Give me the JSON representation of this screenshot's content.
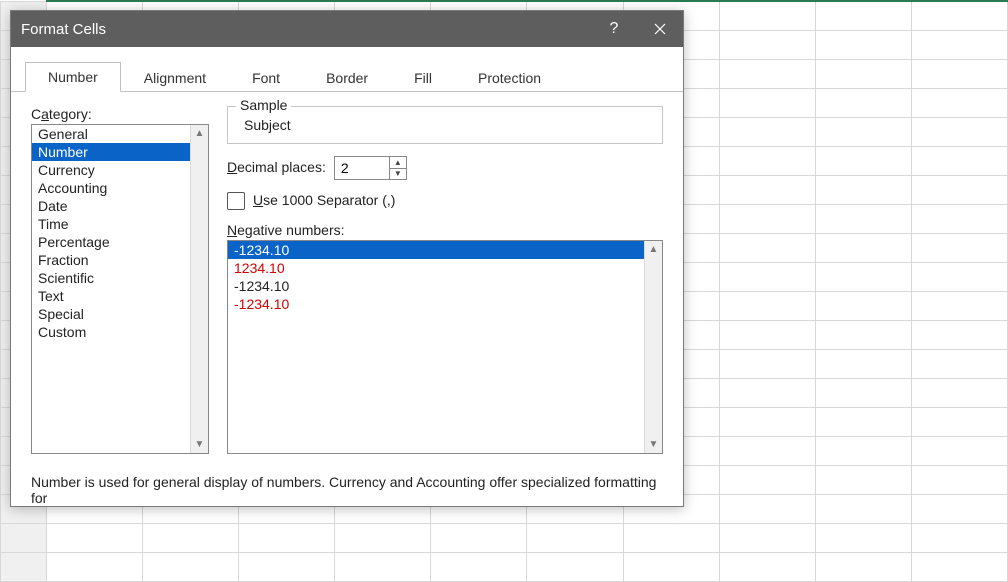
{
  "dialog": {
    "title": "Format Cells",
    "help_tooltip": "?",
    "close_tooltip": "Close"
  },
  "tabs": [
    "Number",
    "Alignment",
    "Font",
    "Border",
    "Fill",
    "Protection"
  ],
  "active_tab_index": 0,
  "category_label_pre": "C",
  "category_label_u": "a",
  "category_label_post": "tegory:",
  "categories": [
    "General",
    "Number",
    "Currency",
    "Accounting",
    "Date",
    "Time",
    "Percentage",
    "Fraction",
    "Scientific",
    "Text",
    "Special",
    "Custom"
  ],
  "selected_category_index": 1,
  "sample": {
    "legend": "Sample",
    "value": "Subject"
  },
  "decimal": {
    "label_pre": "",
    "label_u": "D",
    "label_post": "ecimal places:",
    "value": "2"
  },
  "separator": {
    "label_pre": "",
    "label_u": "U",
    "label_post": "se 1000 Separator (,)",
    "checked": false
  },
  "negative": {
    "label_pre": "",
    "label_u": "N",
    "label_post": "egative numbers:",
    "options": [
      {
        "text": "-1234.10",
        "red": false
      },
      {
        "text": "1234.10",
        "red": true
      },
      {
        "text": "-1234.10",
        "red": false
      },
      {
        "text": "-1234.10",
        "red": true
      }
    ],
    "selected_index": 0
  },
  "description": "Number is used for general display of numbers.  Currency and Accounting offer specialized formatting for"
}
